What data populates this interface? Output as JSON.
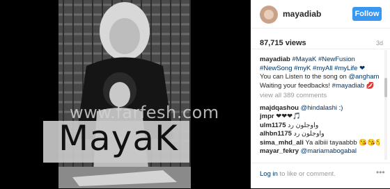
{
  "post": {
    "username": "mayadiab",
    "follow_label": "Follow",
    "views": "87,715 views",
    "age": "3d",
    "caption_line1_user": "mayadiab",
    "caption_line1_tags": "#MayaK #NewFusion",
    "caption_line2": "#NewSong #myK #myAll #myLife ❤",
    "caption_line3_text": "You can Listen to the song on",
    "caption_line3_link": "@anghami",
    "caption_line4_text": "Waiting your feedbacks!",
    "caption_line4_link": "#mayadiab",
    "caption_line4_emoji": "💋",
    "view_all": "view all 389 comments",
    "comments": [
      {
        "user": "majdqashou",
        "text": "@hindalashi :)"
      },
      {
        "user": "jmpr",
        "text": "❤❤❤🎵"
      },
      {
        "user": "ulm1175",
        "text": "واوجلون رد"
      },
      {
        "user": "alhbn1175",
        "text": "واوجلون رد"
      },
      {
        "user": "sima_mhd_ali",
        "text": "Ya albiii tayaabbb 😘😘😘"
      },
      {
        "user": "mayar_fekry",
        "text": "@mariamabogabal"
      }
    ],
    "login_link": "Log in",
    "login_text": "to like or comment."
  },
  "media": {
    "watermark": "www.farfesh.com",
    "banner": "MayaK"
  },
  "icons": {
    "more": "more-icon"
  }
}
